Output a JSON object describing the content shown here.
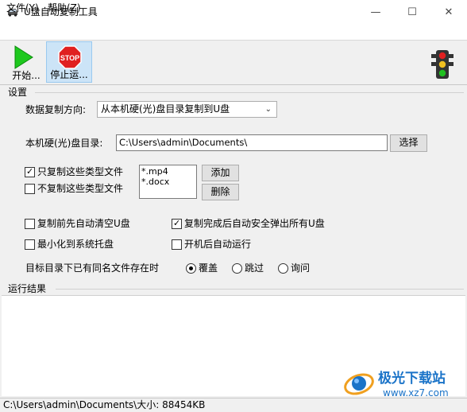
{
  "window": {
    "title": "U盘自动复制工具"
  },
  "menu": {
    "file": "文件(Y)",
    "help": "帮助(Z)"
  },
  "toolbar": {
    "start_label": "开始...",
    "stop_label": "停止运..."
  },
  "settings": {
    "group_title": "设置",
    "direction_label": "数据复制方向:",
    "direction_value": "从本机硬(光)盘目录复制到U盘",
    "dir_label": "本机硬(光)盘目录:",
    "dir_value": "C:\\Users\\admin\\Documents\\",
    "browse_button": "选择",
    "only_copy_label": "只复制这些类型文件",
    "only_copy_checked": true,
    "no_copy_label": "不复制这些类型文件",
    "no_copy_checked": false,
    "extensions": [
      "*.mp4",
      "*.docx"
    ],
    "add_button": "添加",
    "delete_button": "删除",
    "clear_before_label": "复制前先自动清空U盘",
    "clear_before_checked": false,
    "eject_after_label": "复制完成后自动安全弹出所有U盘",
    "eject_after_checked": true,
    "minimize_tray_label": "最小化到系统托盘",
    "minimize_tray_checked": false,
    "autorun_label": "开机后自动运行",
    "autorun_checked": false,
    "conflict_label": "目标目录下已有同名文件存在时",
    "conflict_options": [
      "覆盖",
      "跳过",
      "询问"
    ],
    "conflict_selected": "覆盖"
  },
  "results": {
    "group_title": "运行结果"
  },
  "watermark": {
    "name": "极光下载站",
    "url": "www.xz7.com"
  },
  "status": {
    "text": "C:\\Users\\admin\\Documents\\大小: 88454KB"
  },
  "colors": {
    "accent": "#cce4f7",
    "watermark": "#1a73c8"
  }
}
